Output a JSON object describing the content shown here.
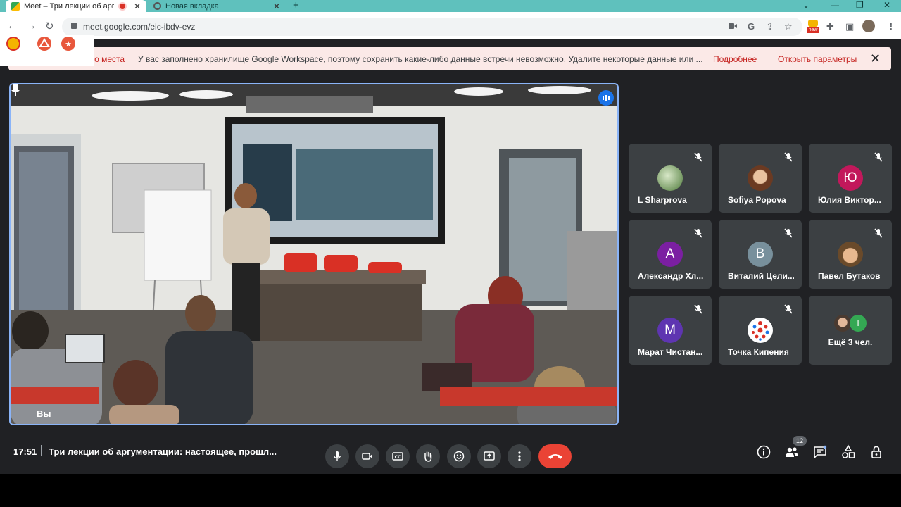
{
  "browser": {
    "tabs": [
      {
        "title": "Meet – Три лекции об аргум"
      },
      {
        "title": "Новая вкладка"
      }
    ],
    "url": "meet.google.com/eic-ibdv-evz",
    "new_badge": "new"
  },
  "banner": {
    "truncated_prefix": "го места",
    "message": "У вас заполнено хранилище Google Workspace, поэтому сохранить какие-либо данные встречи невозможно. Удалите некоторые данные или ...",
    "link_more": "Подробнее",
    "link_settings": "Открыть параметры"
  },
  "main_video": {
    "self_label": "Вы"
  },
  "participants": [
    {
      "name": "L Sharprova",
      "initial": "",
      "color": "#6b8e4e"
    },
    {
      "name": "Sofiya Popova",
      "initial": "",
      "color": "#a0522d"
    },
    {
      "name": "Юлия Виктор...",
      "initial": "Ю",
      "color": "#c2185b"
    },
    {
      "name": "Александр Хл...",
      "initial": "А",
      "color": "#7b1fa2"
    },
    {
      "name": "Виталий Цели...",
      "initial": "В",
      "color": "#78909c"
    },
    {
      "name": "Павел Бутаков",
      "initial": "",
      "color": "#b07a54"
    },
    {
      "name": "Марат Чистан...",
      "initial": "М",
      "color": "#5e35b1"
    },
    {
      "name": "Точка Кипения",
      "initial": "",
      "color": "#ffffff"
    }
  ],
  "more_tile": {
    "label": "Ещё 3 чел.",
    "second_initial": "I"
  },
  "bottom_bar": {
    "time": "17:51",
    "meeting_title": "Три лекции об аргументации: настоящее, прошл...",
    "participants_count": "12"
  },
  "colors": {
    "accent_blue": "#8ab4f8",
    "hangup_red": "#ea4335",
    "tab_strip": "#5fc1bd",
    "meet_bg": "#202124"
  }
}
